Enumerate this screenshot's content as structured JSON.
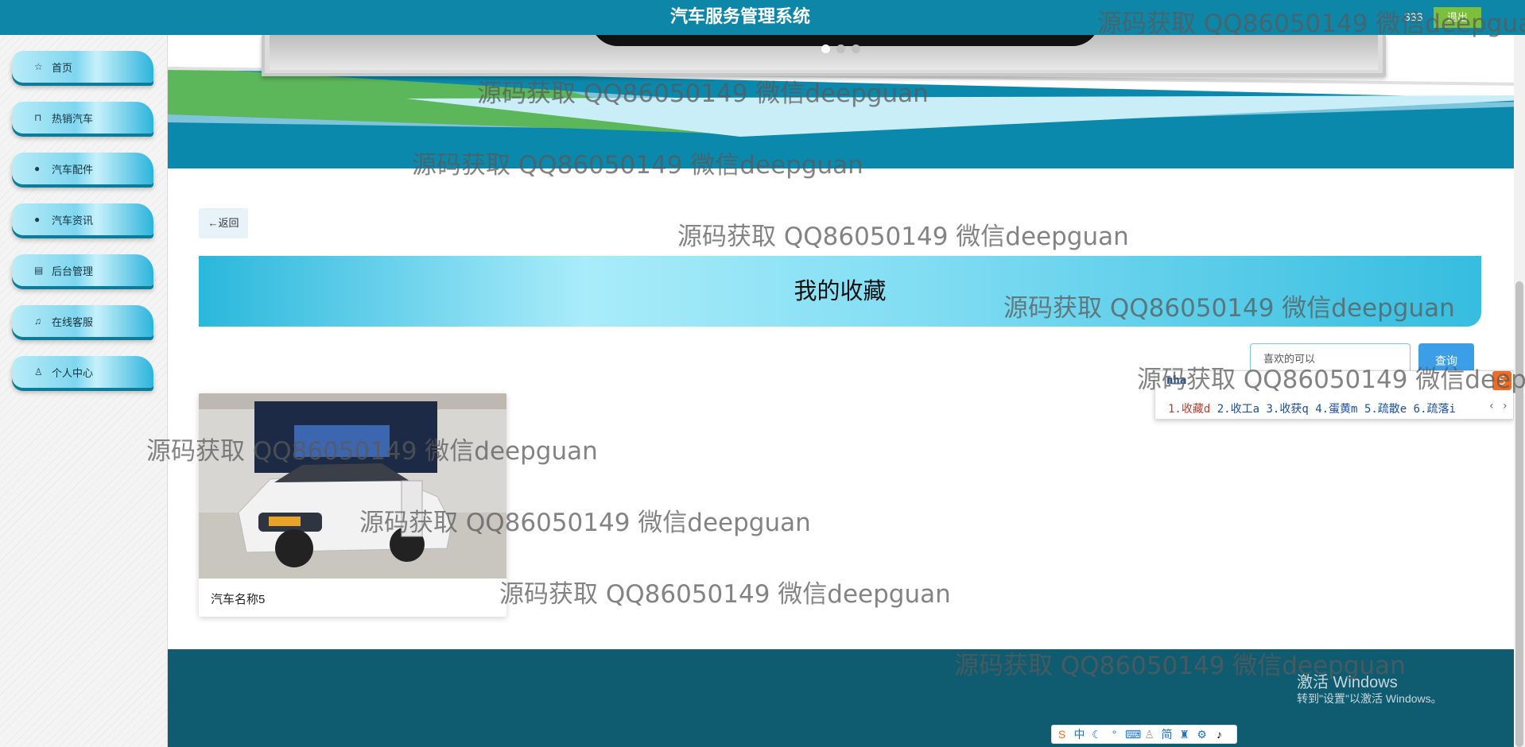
{
  "header": {
    "title": "汽车服务管理系统",
    "user": "333",
    "logout_label": "退出"
  },
  "sidebar": {
    "items": [
      {
        "label": "首页",
        "icon": "star-outline-icon"
      },
      {
        "label": "热销汽车",
        "icon": "shopping-bag-icon"
      },
      {
        "label": "汽车配件",
        "icon": "info-circle-icon"
      },
      {
        "label": "汽车资讯",
        "icon": "question-circle-icon"
      },
      {
        "label": "后台管理",
        "icon": "office-building-icon"
      },
      {
        "label": "在线客服",
        "icon": "headset-icon"
      },
      {
        "label": "个人中心",
        "icon": "user-icon"
      }
    ]
  },
  "carousel": {
    "slide_count": 3,
    "active_index": 0
  },
  "main": {
    "back_label": "返回",
    "section_title": "我的收藏",
    "search": {
      "value": "喜欢的可以",
      "button_label": "查询"
    },
    "cards": [
      {
        "name": "汽车名称5"
      }
    ]
  },
  "ime": {
    "pinyin": "nha",
    "candidates": [
      "1.收藏d",
      "2.收工a",
      "3.收获q",
      "4.蛋黄m",
      "5.疏散e",
      "6.疏落i"
    ]
  },
  "system": {
    "activate_title": "激活 Windows",
    "activate_hint": "转到\"设置\"以激活 Windows。"
  },
  "watermark": "源码获取 QQ86050149 微信deepguan",
  "colors": {
    "topbar": "#0e86a8",
    "footer": "#0f5c71",
    "accent_button": "#3d9ee8",
    "logout": "#7cbf3c"
  }
}
